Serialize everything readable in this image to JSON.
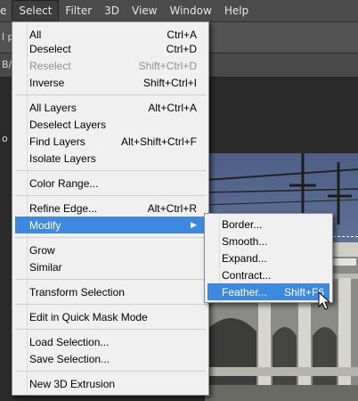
{
  "menubar": {
    "items": [
      {
        "label": "e"
      },
      {
        "label": "Select"
      },
      {
        "label": "Filter"
      },
      {
        "label": "3D"
      },
      {
        "label": "View"
      },
      {
        "label": "Window"
      },
      {
        "label": "Help"
      }
    ]
  },
  "workspace": {
    "fragment_px": "l px",
    "fragment_b": "B/",
    "fragment_o": "o"
  },
  "select_menu": {
    "items": [
      {
        "label": "All",
        "shortcut": "Ctrl+A"
      },
      {
        "label": "Deselect",
        "shortcut": "Ctrl+D"
      },
      {
        "label": "Reselect",
        "shortcut": "Shift+Ctrl+D"
      },
      {
        "label": "Inverse",
        "shortcut": "Shift+Ctrl+I"
      },
      {
        "label": "All Layers",
        "shortcut": "Alt+Ctrl+A"
      },
      {
        "label": "Deselect Layers",
        "shortcut": ""
      },
      {
        "label": "Find Layers",
        "shortcut": "Alt+Shift+Ctrl+F"
      },
      {
        "label": "Isolate Layers",
        "shortcut": ""
      },
      {
        "label": "Color Range...",
        "shortcut": ""
      },
      {
        "label": "Refine Edge...",
        "shortcut": "Alt+Ctrl+R"
      },
      {
        "label": "Modify",
        "shortcut": ""
      },
      {
        "label": "Grow",
        "shortcut": ""
      },
      {
        "label": "Similar",
        "shortcut": ""
      },
      {
        "label": "Transform Selection",
        "shortcut": ""
      },
      {
        "label": "Edit in Quick Mask Mode",
        "shortcut": ""
      },
      {
        "label": "Load Selection...",
        "shortcut": ""
      },
      {
        "label": "Save Selection...",
        "shortcut": ""
      },
      {
        "label": "New 3D Extrusion",
        "shortcut": ""
      }
    ]
  },
  "modify_menu": {
    "items": [
      {
        "label": "Border...",
        "shortcut": ""
      },
      {
        "label": "Smooth...",
        "shortcut": ""
      },
      {
        "label": "Expand...",
        "shortcut": ""
      },
      {
        "label": "Contract...",
        "shortcut": ""
      },
      {
        "label": "Feather...",
        "shortcut": "Shift+F6"
      }
    ]
  },
  "colors": {
    "highlight": "#3d89e0",
    "menu_bg": "#f0f0f0",
    "menubar_bg": "#4b4b4b"
  }
}
